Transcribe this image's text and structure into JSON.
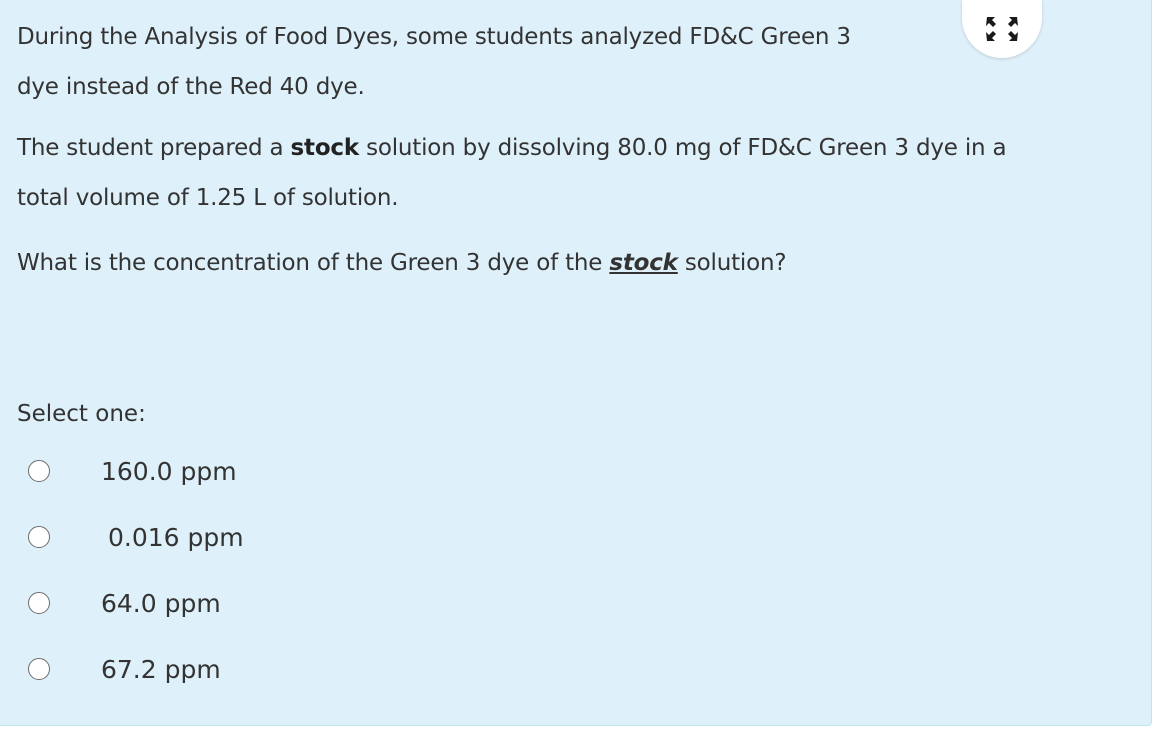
{
  "question": {
    "line1": "During the Analysis of Food Dyes, some students analyzed FD&C Green 3",
    "line2": "dye instead of the Red 40 dye.",
    "p2_before": "The student prepared a ",
    "p2_bold": "stock",
    "p2_after_line1": " solution by dissolving 80.0 mg of FD&C Green 3 dye in a",
    "p2_line2": "total volume of 1.25 L of solution.",
    "p3_before": "What is the concentration of the Green 3 dye of the ",
    "p3_emph": "stock",
    "p3_after": " solution?"
  },
  "select_label": "Select one:",
  "options": [
    {
      "label": "160.0 ppm",
      "selected": false
    },
    {
      "label": "0.016 ppm",
      "selected": false
    },
    {
      "label": "64.0 ppm",
      "selected": false
    },
    {
      "label": "67.2 ppm",
      "selected": false
    }
  ],
  "toolbar": {
    "expand_icon": "expand-arrows-icon"
  },
  "colors": {
    "panel_bg": "#def0f9",
    "text": "#333333",
    "icon": "#1a1a1a"
  }
}
